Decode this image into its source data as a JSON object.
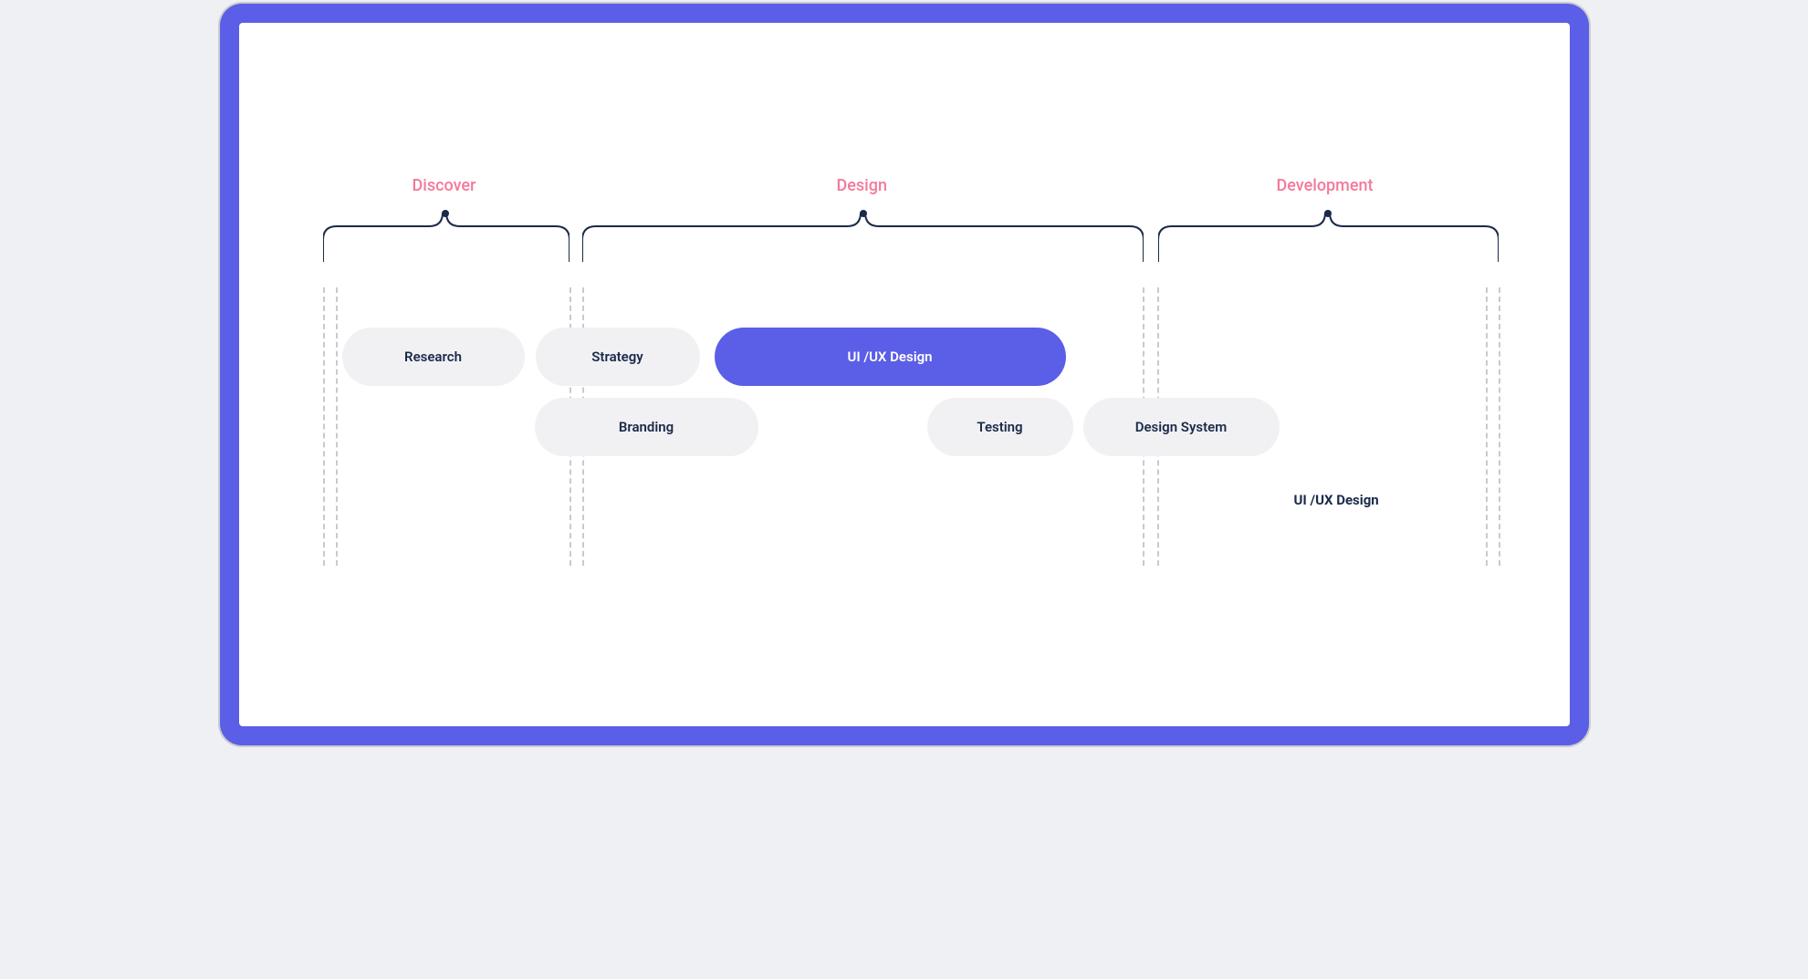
{
  "colors": {
    "frame": "#5b5ee6",
    "accent": "#5b5ee6",
    "pill": "#f1f1f4",
    "text": "#1b2a4a",
    "phase_label": "#f47a9a",
    "dash": "#c7cad1"
  },
  "phases": {
    "discover": {
      "label": "Discover"
    },
    "design": {
      "label": "Design"
    },
    "development": {
      "label": "Development"
    }
  },
  "activities": {
    "research": {
      "label": "Research"
    },
    "strategy": {
      "label": "Strategy"
    },
    "uiux": {
      "label": "UI /UX Design"
    },
    "branding": {
      "label": "Branding"
    },
    "testing": {
      "label": "Testing"
    },
    "design_system": {
      "label": "Design System"
    },
    "uiux_dev": {
      "label": "UI /UX Design"
    }
  }
}
